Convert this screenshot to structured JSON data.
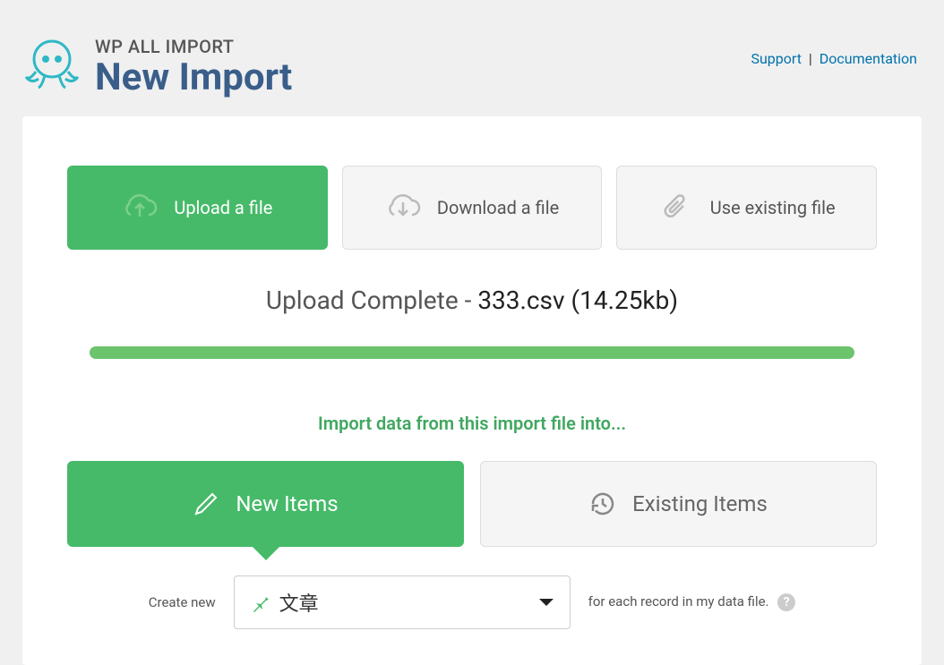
{
  "header": {
    "brand": "WP ALL IMPORT",
    "title": "New Import",
    "links": {
      "support": "Support",
      "documentation": "Documentation"
    }
  },
  "tabs": {
    "upload": "Upload a file",
    "download": "Download a file",
    "existing": "Use existing file"
  },
  "upload_status": {
    "label": "Upload Complete",
    "separator": " - ",
    "filename": "333.csv (14.25kb)"
  },
  "import_into": "Import data from this import file into...",
  "mode": {
    "new_items": "New Items",
    "existing_items": "Existing Items"
  },
  "create": {
    "prefix": "Create new",
    "selected": "文章",
    "suffix": "for each record in my data file."
  }
}
